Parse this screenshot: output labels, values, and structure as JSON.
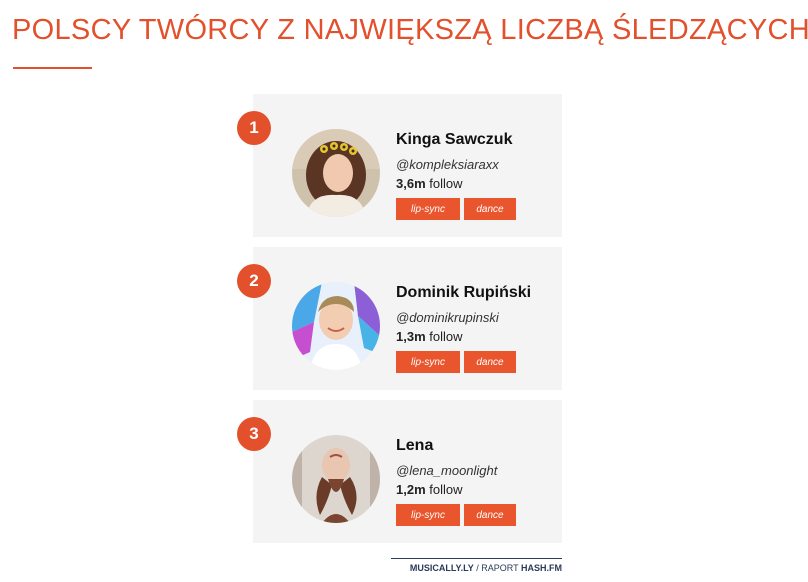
{
  "header": {
    "title": "POLSCY TWÓRCY Z NAJWIĘKSZĄ LICZBĄ ŚLEDZĄCYCH"
  },
  "creators": [
    {
      "rank": "1",
      "name": "Kinga Sawczuk",
      "handle": "@kompleksiaraxx",
      "followers": "3,6m",
      "follow_label": "follow",
      "tags": [
        "lip-sync",
        "dance"
      ]
    },
    {
      "rank": "2",
      "name": "Dominik Rupiński",
      "handle": "@dominikrupinski",
      "followers": "1,3m",
      "follow_label": "follow",
      "tags": [
        "lip-sync",
        "dance"
      ]
    },
    {
      "rank": "3",
      "name": "Lena",
      "handle": "@lena_moonlight",
      "followers": "1,2m",
      "follow_label": "follow",
      "tags": [
        "lip-sync",
        "dance"
      ]
    }
  ],
  "footer": {
    "source": "MUSICALLY.LY",
    "separator": "/",
    "report_label": "RAPORT",
    "brand": "HASH.FM"
  },
  "colors": {
    "accent": "#e2502c",
    "tag": "#e9552d",
    "card": "#f4f4f4",
    "footer_text": "#2a3b59"
  }
}
